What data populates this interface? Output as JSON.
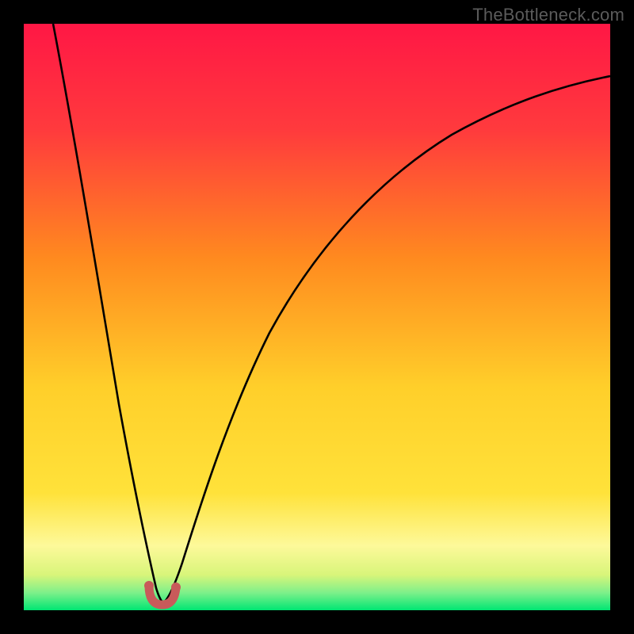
{
  "watermark": "TheBottleneck.com",
  "colors": {
    "red": "#ff1745",
    "orange": "#ff8a1f",
    "yellow": "#ffe23a",
    "lightyellow": "#fdf99a",
    "green": "#00e673",
    "curve": "#000000",
    "marker": "#c85a5a",
    "bg": "#000000"
  },
  "chart_data": {
    "type": "line",
    "title": "",
    "xlabel": "",
    "ylabel": "",
    "xlim": [
      0,
      100
    ],
    "ylim": [
      0,
      100
    ],
    "grid": false,
    "note": "Bottleneck-style curve: two branches descending into a single minimum near x≈23, y≈0. Values below are approximate readings from the plot (background gradient runs red→green top→bottom corresponding to high→low bottleneck %).",
    "series": [
      {
        "name": "left-branch",
        "x": [
          5,
          8,
          11,
          14,
          17,
          20,
          22,
          23
        ],
        "values": [
          100,
          80,
          60,
          42,
          27,
          13,
          4,
          0
        ]
      },
      {
        "name": "right-branch",
        "x": [
          23,
          25,
          27,
          30,
          35,
          40,
          50,
          60,
          70,
          80,
          90,
          100
        ],
        "values": [
          0,
          6,
          14,
          25,
          40,
          51,
          66,
          75,
          81,
          85,
          88,
          90
        ]
      }
    ],
    "minimum_marker": {
      "x": 23,
      "y": 0,
      "shape": "rounded-u"
    }
  }
}
